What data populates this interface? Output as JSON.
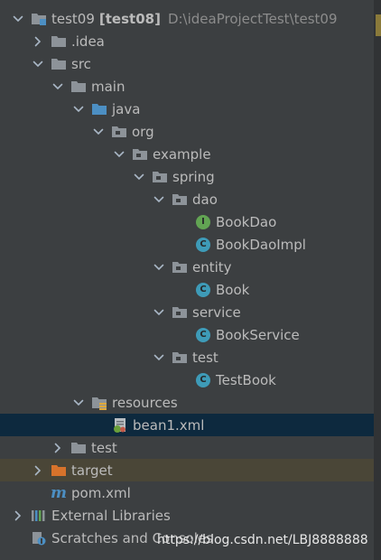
{
  "project": {
    "name": "test09",
    "module": "[test08]",
    "path": "D:\\ideaProjectTest\\test09"
  },
  "tree": {
    "idea": ".idea",
    "src": "src",
    "main": "main",
    "java": "java",
    "org": "org",
    "example": "example",
    "spring": "spring",
    "dao": "dao",
    "book_dao": "BookDao",
    "book_dao_impl": "BookDaoImpl",
    "entity": "entity",
    "book": "Book",
    "service": "service",
    "book_service": "BookService",
    "test_pkg": "test",
    "test_book": "TestBook",
    "resources": "resources",
    "bean1": "bean1.xml",
    "test_dir": "test",
    "target": "target",
    "pom": "pom.xml",
    "external_libraries": "External Libraries",
    "scratches": "Scratches and Consoles"
  },
  "badges": {
    "class_letter": "C",
    "interface_letter": "I",
    "maven_letter": "m"
  },
  "colors": {
    "background": "#3c3f41",
    "selection": "#0d293e",
    "excluded_bg": "#4a4637",
    "source_folder": "#4c8fc3",
    "class_icon": "#3e9bb8",
    "interface_icon": "#62a453"
  },
  "watermark": "https://blog.csdn.net/LBJ8888888"
}
